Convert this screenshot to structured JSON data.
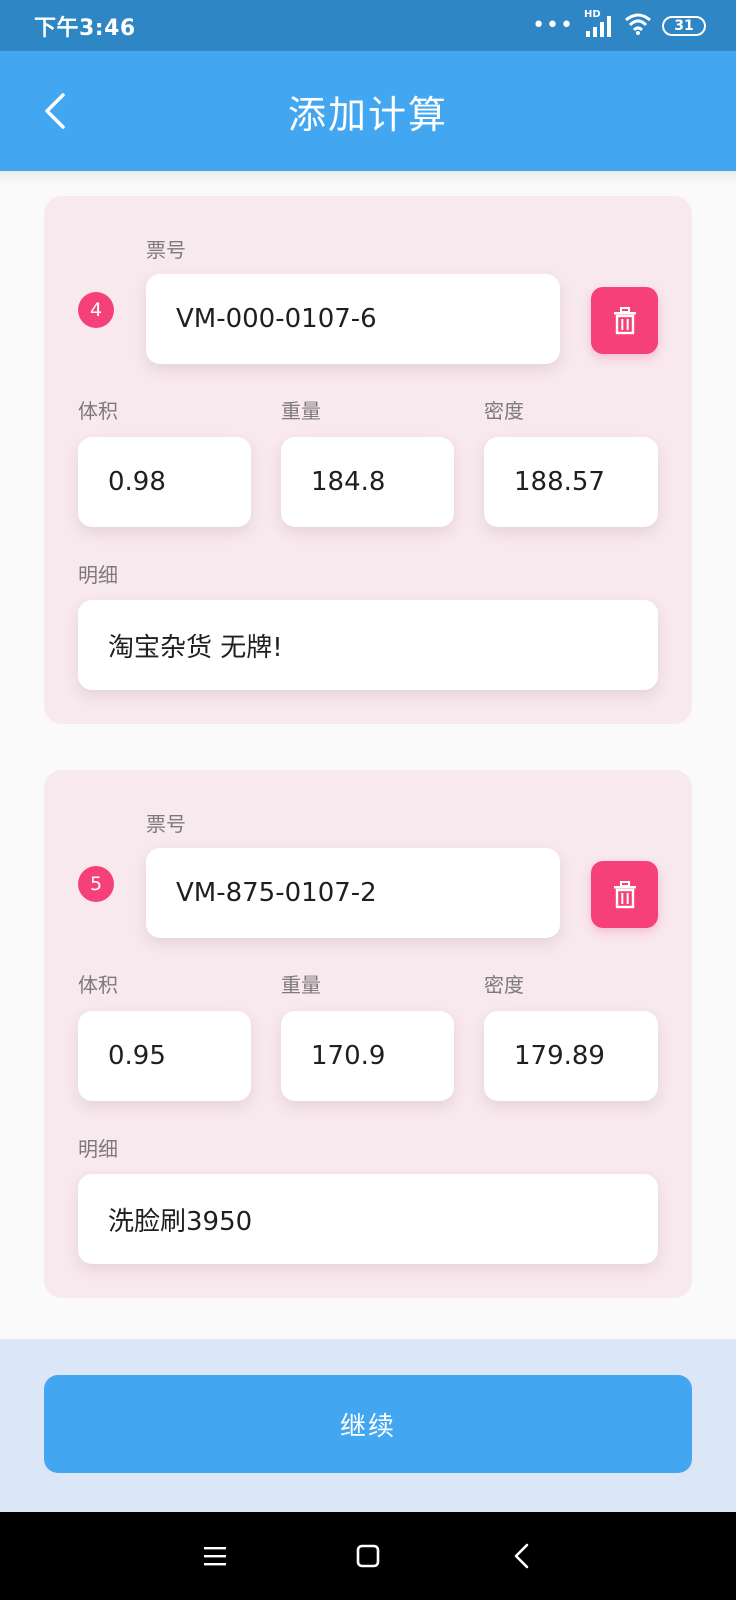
{
  "status_bar": {
    "time": "下午3:46",
    "signal_tag": "HD",
    "battery": "31",
    "icons": [
      "more-dots-icon",
      "signal-icon",
      "wifi-icon",
      "battery-icon"
    ]
  },
  "header": {
    "title": "添加计算",
    "back_icon": "chevron-left-icon"
  },
  "labels": {
    "ticket": "票号",
    "volume": "体积",
    "weight": "重量",
    "density": "密度",
    "detail": "明细"
  },
  "items": [
    {
      "index": "4",
      "ticket": "VM-000-0107-6",
      "volume": "0.98",
      "weight": "184.8",
      "density": "188.57",
      "detail": "淘宝杂货 无牌!"
    },
    {
      "index": "5",
      "ticket": "VM-875-0107-2",
      "volume": "0.95",
      "weight": "170.9",
      "density": "179.89",
      "detail": "洗脸刷3950"
    }
  ],
  "footer": {
    "continue_label": "继续"
  },
  "nav": {
    "icons": [
      "menu-icon",
      "home-square-icon",
      "back-triangle-icon"
    ]
  },
  "colors": {
    "primary": "#42a7f0",
    "status_bar": "#2e86c4",
    "accent": "#f5407a",
    "card_bg": "#f8e9ee",
    "footer_bg": "#dbe6f6"
  }
}
